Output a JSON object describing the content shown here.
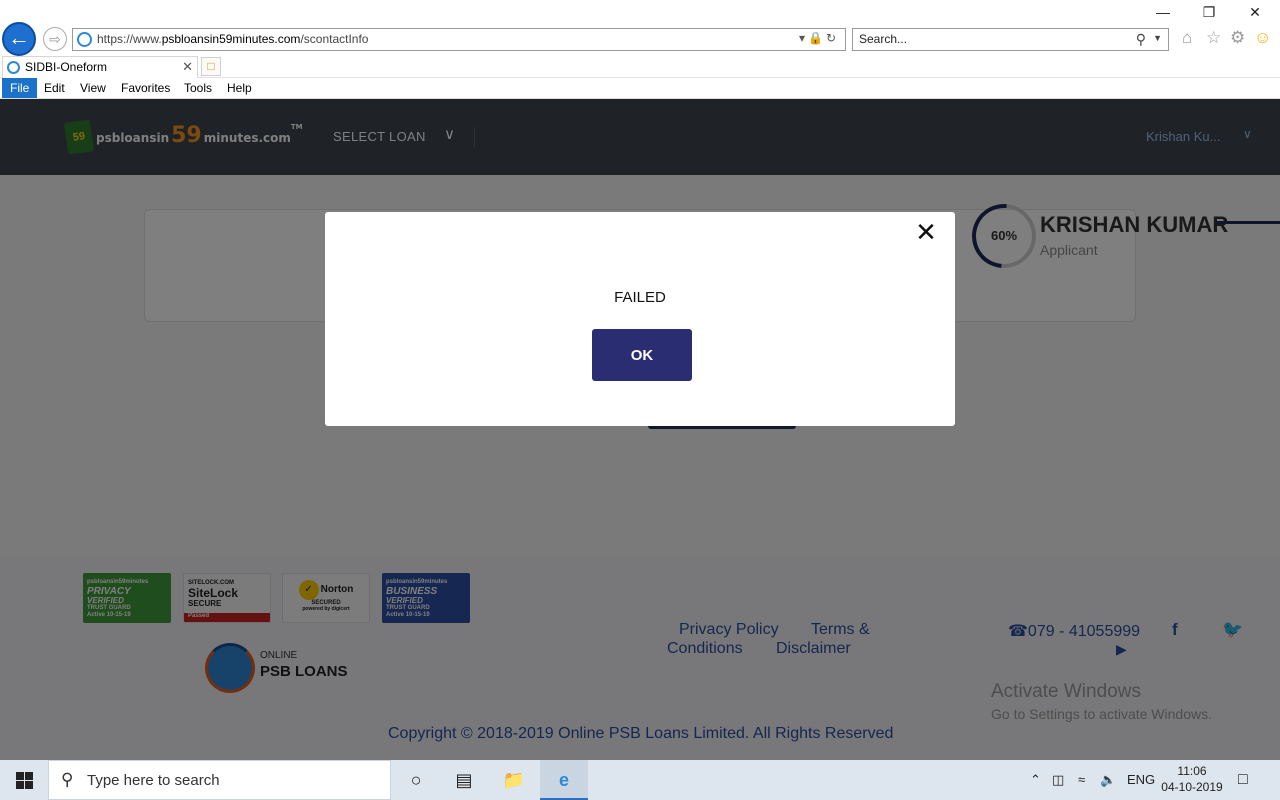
{
  "browser": {
    "url_prefix": "https://www.",
    "url_domain": "psbloansin59minutes.com",
    "url_path": "/scontactInfo",
    "search_placeholder": "Search...",
    "tab_title": "SIDBI-Oneform",
    "menu": [
      "File",
      "Edit",
      "View",
      "Favorites",
      "Tools",
      "Help"
    ]
  },
  "site": {
    "logo_psb": "PSB",
    "logo_num_badge": "59",
    "logo_part1": "psbloansin",
    "logo_number": "59",
    "logo_part2": "minutes.com",
    "logo_tm": "TM",
    "select_loan": "SELECT LOAN",
    "user_name": "Krishan Ku..."
  },
  "profile": {
    "progress": "60%",
    "name": "KRISHAN KUMAR",
    "role": "Applicant"
  },
  "modal": {
    "message": "FAILED",
    "ok_label": "OK"
  },
  "footer": {
    "seals": {
      "privacy_top": "psbloansin59minutes",
      "privacy_main": "PRIVACY",
      "privacy_sub": "VERIFIED",
      "privacy_trust": "TRUST GUARD",
      "privacy_date": "Active 10-15-19",
      "sitelock_top": "SITELOCK.COM",
      "sitelock_main": "SiteLock",
      "sitelock_sub": "SECURE",
      "sitelock_status": "Passed",
      "norton_main": "Norton",
      "norton_sub": "SECURED",
      "norton_powered": "powered by digicert",
      "business_top": "psbloansin59minutes",
      "business_main": "BUSINESS",
      "business_sub": "VERIFIED",
      "business_trust": "TRUST GUARD",
      "business_date": "Active 10-15-19"
    },
    "psb_online": "ONLINE",
    "psb_loans": "PSB LOANS",
    "privacy_policy": "Privacy Policy",
    "terms_line1": "Terms &",
    "terms_line2": "Conditions",
    "disclaimer": "Disclaimer",
    "phone": "☎079 - 41055999",
    "copyright": "Copyright © 2018-2019 Online PSB Loans Limited. All Rights Reserved"
  },
  "watermark": {
    "title": "Activate Windows",
    "subtitle": "Go to Settings to activate Windows."
  },
  "taskbar": {
    "search_placeholder": "Type here to search",
    "language": "ENG",
    "time": "11:06",
    "date": "04-10-2019"
  },
  "icons": {
    "back": "back-arrow-icon",
    "forward": "forward-arrow-icon",
    "accent": "#2b2d72",
    "header_bg": "#3e4650",
    "link_color": "#2b4fa0"
  }
}
